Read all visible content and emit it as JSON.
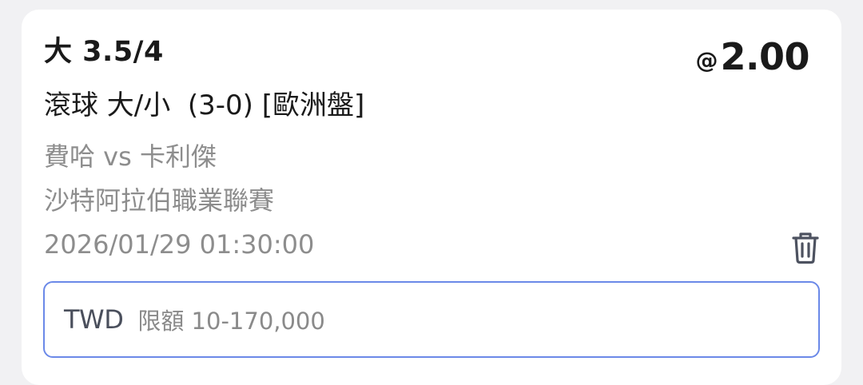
{
  "bet": {
    "selection": "大 3.5/4",
    "odds_prefix": "@",
    "odds_value": "2.00",
    "market": "滾球 大/小  (3-0) [歐洲盤]",
    "teams": "費哈 vs 卡利傑",
    "league": "沙特阿拉伯職業聯賽",
    "datetime": "2026/01/29 01:30:00"
  },
  "stake": {
    "currency": "TWD",
    "limit_text": "限額 10-170,000"
  },
  "icons": {
    "delete": "trash-icon"
  },
  "colors": {
    "input_border": "#6b89e8",
    "secondary_text": "#8d8d8d",
    "primary_text": "#1a1a1a"
  }
}
